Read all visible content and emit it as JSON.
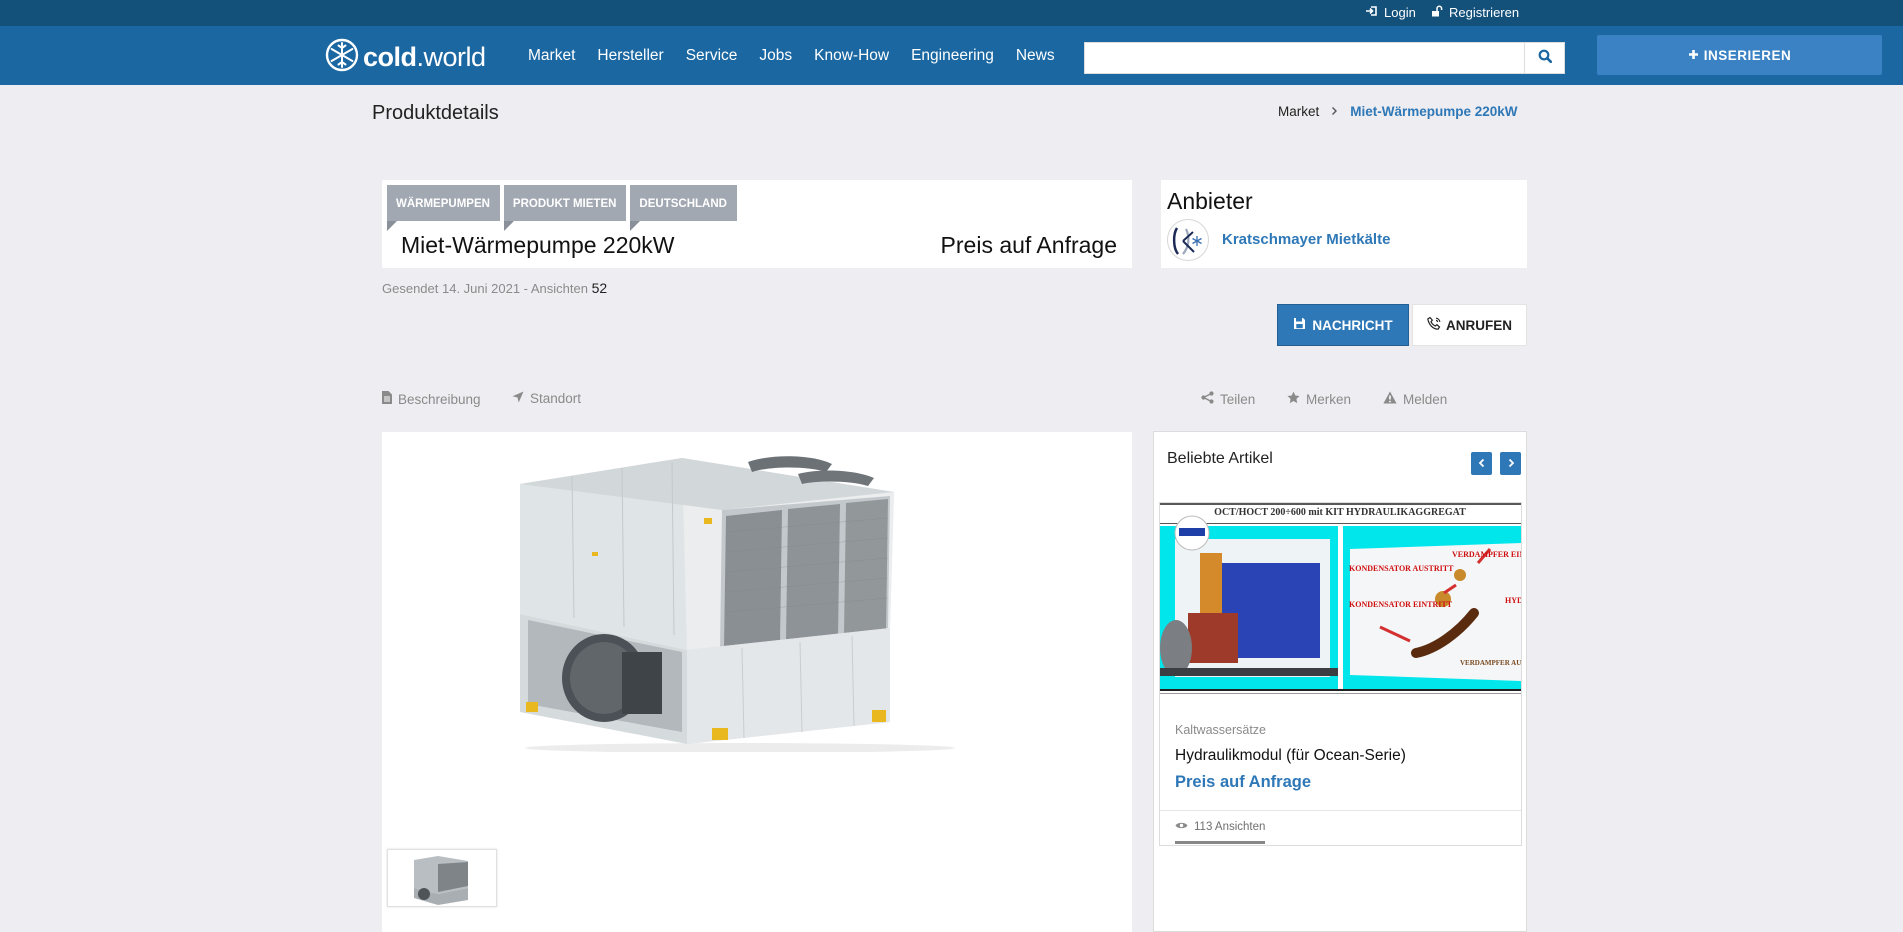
{
  "topbar": {
    "login": "Login",
    "register": "Registrieren"
  },
  "brand": {
    "name_part1": "cold",
    "name_part2": ".world"
  },
  "nav": [
    "Market",
    "Hersteller",
    "Service",
    "Jobs",
    "Know-How",
    "Engineering",
    "News"
  ],
  "search": {
    "value": "",
    "placeholder": ""
  },
  "insert_button": "INSERIEREN",
  "page": {
    "title": "Produktdetails"
  },
  "breadcrumb": {
    "parent": "Market",
    "current": "Miet-Wärmepumpe 220kW"
  },
  "product": {
    "tags": [
      "WÄRMEPUMPEN",
      "PRODUKT MIETEN",
      "DEUTSCHLAND"
    ],
    "title": "Miet-Wärmepumpe 220kW",
    "price": "Preis auf Anfrage",
    "sent_label": "Gesendet 14. Juni 2021 - Ansichten",
    "views": "52"
  },
  "provider": {
    "heading": "Anbieter",
    "name": "Kratschmayer Mietkälte"
  },
  "actions": {
    "message": "NACHRICHT",
    "call": "ANRUFEN"
  },
  "tabs": {
    "description": "Beschreibung",
    "location": "Standort",
    "share": "Teilen",
    "bookmark": "Merken",
    "report": "Melden"
  },
  "popular": {
    "heading": "Beliebte Artikel",
    "article": {
      "image_title": "OCT/HOCT 200÷600 mit KIT HYDRAULIKAGGREGAT",
      "image_labels": [
        "KONDENSATOR AUSTRITT",
        "KONDENSATOR EINTRITT",
        "VERDAMPFER EINTRITT",
        "VERDAMPFER AUSTRITT",
        "HYD EIN"
      ],
      "category": "Kaltwassersätze",
      "title": "Hydraulikmodul (für Ocean-Serie)",
      "price": "Preis auf Anfrage",
      "views": "113 Ansichten"
    },
    "carousel_progress": 1.0
  },
  "colors": {
    "topbar": "#13507a",
    "navbar": "#1a67a2",
    "accent": "#2e78b7",
    "background": "#eeedf1",
    "tag": "#a2a8b2"
  }
}
